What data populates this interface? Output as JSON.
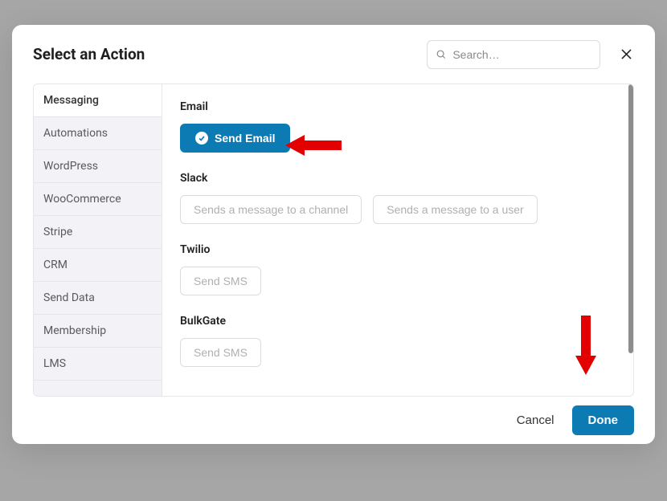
{
  "modal": {
    "title": "Select an Action",
    "search_placeholder": "Search…"
  },
  "sidebar": {
    "items": [
      {
        "label": "Messaging",
        "active": true
      },
      {
        "label": "Automations",
        "active": false
      },
      {
        "label": "WordPress",
        "active": false
      },
      {
        "label": "WooCommerce",
        "active": false
      },
      {
        "label": "Stripe",
        "active": false
      },
      {
        "label": "CRM",
        "active": false
      },
      {
        "label": "Send Data",
        "active": false
      },
      {
        "label": "Membership",
        "active": false
      },
      {
        "label": "LMS",
        "active": false
      }
    ]
  },
  "sections": [
    {
      "heading": "Email",
      "actions": [
        {
          "label": "Send Email",
          "selected": true
        }
      ]
    },
    {
      "heading": "Slack",
      "actions": [
        {
          "label": "Sends a message to a channel",
          "selected": false
        },
        {
          "label": "Sends a message to a user",
          "selected": false
        }
      ]
    },
    {
      "heading": "Twilio",
      "actions": [
        {
          "label": "Send SMS",
          "selected": false
        }
      ]
    },
    {
      "heading": "BulkGate",
      "actions": [
        {
          "label": "Send SMS",
          "selected": false
        }
      ]
    }
  ],
  "footer": {
    "cancel": "Cancel",
    "done": "Done"
  }
}
